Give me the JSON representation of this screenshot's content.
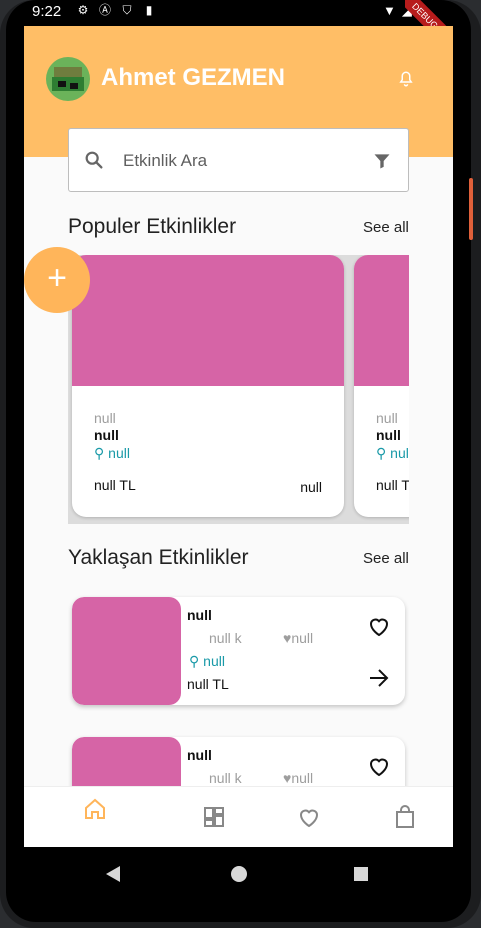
{
  "status_bar": {
    "time": "9:22",
    "debug_banner": "DEBUG"
  },
  "header": {
    "username": "Ahmet GEZMEN"
  },
  "search": {
    "placeholder": "Etkinlik Ara"
  },
  "popular": {
    "title": "Populer Etkinlikler",
    "see_all": "See all",
    "cards": [
      {
        "category": "null",
        "name": "null",
        "location": "null",
        "price": "null TL",
        "date": "null"
      },
      {
        "category": "null",
        "name": "null",
        "location": "null",
        "price": "null TL",
        "date": ""
      }
    ]
  },
  "upcoming": {
    "title": "Yaklaşan Etkinlikler",
    "see_all": "See all",
    "cards": [
      {
        "name": "null",
        "distance": "null k",
        "likes": "null",
        "location": "null",
        "price": "null TL"
      },
      {
        "name": "null",
        "distance": "null k",
        "likes": "null",
        "location": "",
        "price": ""
      }
    ]
  },
  "fab": {
    "label": "+"
  },
  "bottom_nav": {
    "items": [
      {
        "icon": "home-icon",
        "active": true
      },
      {
        "icon": "dashboard-icon",
        "active": false
      },
      {
        "icon": "heart-icon",
        "active": false
      },
      {
        "icon": "shopping-bag-icon",
        "active": false
      }
    ]
  },
  "colors": {
    "header": "#ffbe66",
    "accent": "#ffb55a",
    "card_image": "#d664a6",
    "location": "#1a9aa8"
  }
}
